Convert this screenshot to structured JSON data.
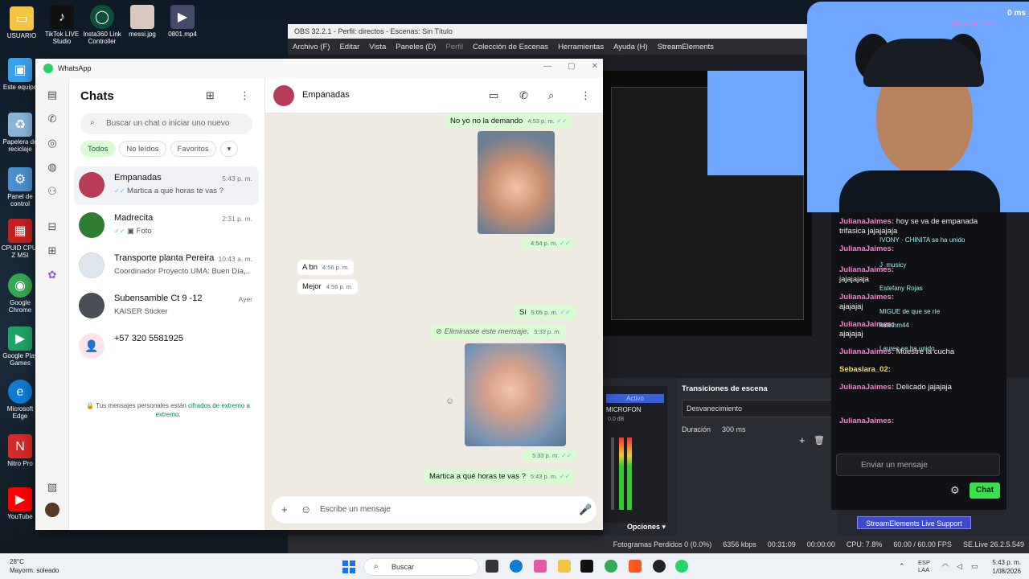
{
  "desktop": {
    "icons": [
      {
        "label": "USUARIO",
        "icon": "folder-icon",
        "color": "#f4c542"
      },
      {
        "label": "TikTok LIVE Studio",
        "icon": "tiktok-icon",
        "color": "#111111"
      },
      {
        "label": "Insta360 Link Controller",
        "icon": "camera-icon",
        "color": "#0d4f3c"
      },
      {
        "label": "messi.jpg",
        "icon": "image-icon",
        "color": "#d0d0d0"
      },
      {
        "label": "0801.mp4",
        "icon": "video-icon",
        "color": "#444a6a"
      },
      {
        "label": "Este equipo",
        "icon": "monitor-icon",
        "color": "#3aa0e8"
      },
      {
        "label": "Papelera de reciclaje",
        "icon": "recycle-bin-icon",
        "color": "#8ab4d8"
      },
      {
        "label": "Panel de control",
        "icon": "control-panel-icon",
        "color": "#4a8fd0"
      },
      {
        "label": "CPUID CPU-Z MSI",
        "icon": "cpu-icon",
        "color": "#c42020"
      },
      {
        "label": "Google Chrome",
        "icon": "chrome-icon",
        "color": "#34a853"
      },
      {
        "label": "Google Play Games",
        "icon": "play-games-icon",
        "color": "#21a366"
      },
      {
        "label": "Microsoft Edge",
        "icon": "edge-icon",
        "color": "#0f7bd4"
      },
      {
        "label": "Nitro Pro",
        "icon": "nitro-icon",
        "color": "#d62b2b"
      },
      {
        "label": "YouTube",
        "icon": "youtube-icon",
        "color": "#ff0000"
      }
    ]
  },
  "obs": {
    "title": "OBS 32.2.1 - Perfil: directos - Escenas: Sin Título",
    "menu": [
      "Archivo (F)",
      "Editar",
      "Vista",
      "Paneles (D)",
      "Perfil",
      "Colección de Escenas",
      "Herramientas",
      "Ayuda (H)",
      "StreamElements"
    ],
    "transitions_title": "Transiciones de escena",
    "transition": "Desvanecimiento",
    "duration_label": "Duración",
    "duration_value": "300 ms",
    "audio_active": "Activo",
    "audio_source": "MICROFON",
    "audio_db": "0.0 dB",
    "options": "Opciones",
    "status": {
      "dropped": "Fotogramas Perdidos 0 (0.0%)",
      "bitrate": "6356 kbps",
      "live_time": "00:31:09",
      "rec_time": "00:00:00",
      "cpu": "CPU: 7.8%",
      "fps": "60.00 / 60.00 FPS",
      "version": "SE.Live 26.2.5.549"
    },
    "se_support": "StreamElements Live Support"
  },
  "cam": {
    "name": "JulianaJaimes:",
    "time": "0 ms"
  },
  "stream_chat": {
    "lines": [
      {
        "user": "JulianaJaimes:",
        "text": "hoy se va de empanada trifasica jajajajaja"
      },
      {
        "user": "JulianaJaimes:",
        "text": ""
      },
      {
        "user": "JulianaJaimes:",
        "text": "jajajajaja"
      },
      {
        "user": "JulianaJaimes:",
        "text": "ajajajaj"
      },
      {
        "user": "JulianaJaimes:",
        "text": "ajajajaj"
      },
      {
        "user": "JulianaJaimes:",
        "text": "Muestre la cucha"
      },
      {
        "user": "Sebaslara_02:",
        "text": ""
      },
      {
        "user": "JulianaJaimes:",
        "text": "Delicado jajajaja"
      },
      {
        "user": "JulianaJaimes:",
        "text": ""
      }
    ],
    "overlay_users": [
      "IVONY",
      "CHINITA",
      "J_musicy",
      "Estefany Rojas",
      "MIGUE",
      "kalethm44",
      "Lauren"
    ],
    "overlay_text": [
      "se ha unido",
      "de que se ríe",
      "Muestre la cucha",
      "se ha unido"
    ],
    "input_placeholder": "Enviar un mensaje",
    "send_label": "Chat"
  },
  "whatsapp": {
    "window_title": "WhatsApp",
    "chats_title": "Chats",
    "search_placeholder": "Buscar un chat o iniciar uno nuevo",
    "filters": [
      "Todos",
      "No leídos",
      "Favoritos"
    ],
    "chats": [
      {
        "name": "Empanadas",
        "preview": "Martica a qué horas te vas ?",
        "time": "5:43 p. m.",
        "avatar_color": "#b83b57"
      },
      {
        "name": "Madrecita",
        "preview": "Foto",
        "time": "2:31 p. m.",
        "avatar_color": "#2e7d32"
      },
      {
        "name": "Transporte planta Pereira",
        "preview": "Coordinador Proyecto UMA: Buen Día,...",
        "time": "10:43 a. m.",
        "avatar_color": "#dfe6ee"
      },
      {
        "name": "Subensamble Ct 9 -12",
        "preview": "KAISER Sticker",
        "time": "Ayer",
        "avatar_color": "#4a4f55"
      },
      {
        "name": "+57 320 5581925",
        "preview": "",
        "time": "",
        "avatar_color": "#fde4ec"
      }
    ],
    "encryption_note": "Tus mensajes personales están",
    "encryption_link": "cifrados de extremo a extremo.",
    "conversation": {
      "name": "Empanadas",
      "messages": [
        {
          "dir": "out",
          "text": "No yo no la demando",
          "time": "4:53 p. m."
        },
        {
          "dir": "out",
          "text": "",
          "time": "4:54 p. m."
        },
        {
          "dir": "in",
          "text": "A bn",
          "time": "4:56 p. m."
        },
        {
          "dir": "in",
          "text": "Mejor",
          "time": "4:56 p. m."
        },
        {
          "dir": "out",
          "text": "Si",
          "time": "5:05 p. m."
        },
        {
          "dir": "out",
          "text": "Eliminaste este mensaje.",
          "time": "5:33 p. m."
        },
        {
          "dir": "out",
          "text": "",
          "time": "5:33 p. m."
        },
        {
          "dir": "out",
          "text": "Martica a qué horas te vas ?",
          "time": "5:43 p. m."
        }
      ],
      "composer_placeholder": "Escribe un mensaje"
    }
  },
  "taskbar": {
    "weather_temp": "28°C",
    "weather_desc": "Mayorm. soleado",
    "search_label": "Buscar",
    "lang": "ESP",
    "lang2": "LAA",
    "time": "5:43 p. m.",
    "date": "1/08/2026"
  }
}
